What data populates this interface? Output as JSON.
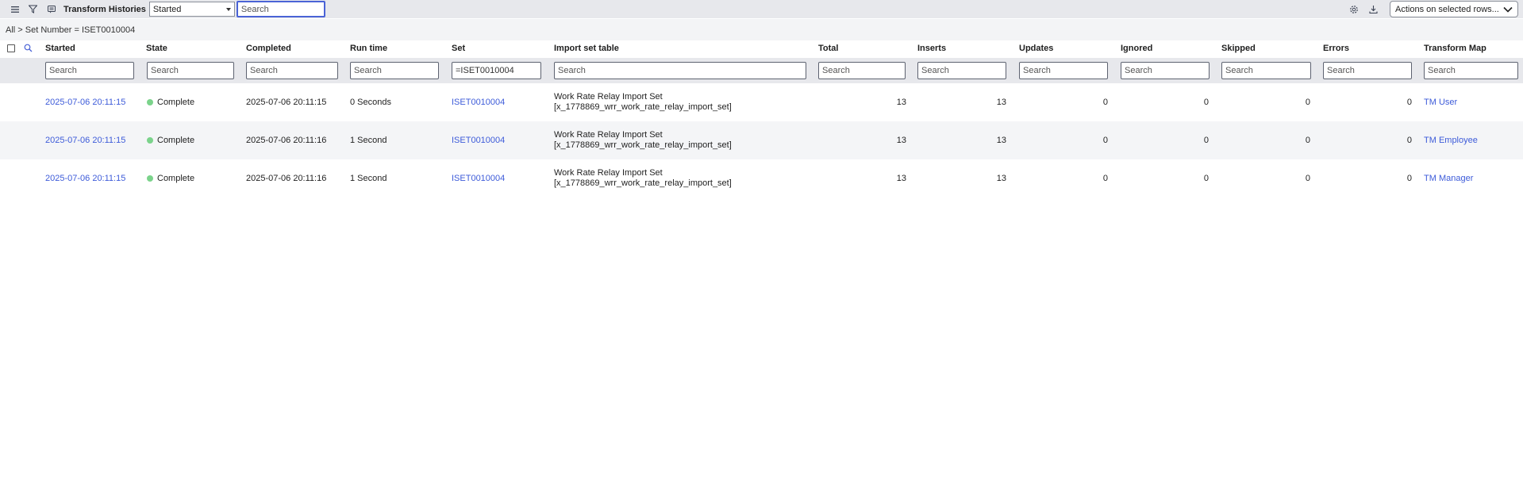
{
  "toolbar": {
    "title": "Transform Histories",
    "field_select": "Started",
    "search_placeholder": "Search",
    "actions_label": "Actions on selected rows..."
  },
  "breadcrumb": "All > Set Number = ISET0010004",
  "columns": [
    {
      "label": "Started",
      "filter_value": "",
      "filter_placeholder": "Search"
    },
    {
      "label": "State",
      "filter_value": "",
      "filter_placeholder": "Search"
    },
    {
      "label": "Completed",
      "filter_value": "",
      "filter_placeholder": "Search"
    },
    {
      "label": "Run time",
      "filter_value": "",
      "filter_placeholder": "Search"
    },
    {
      "label": "Set",
      "filter_value": "=ISET0010004",
      "filter_placeholder": "Search"
    },
    {
      "label": "Import set table",
      "filter_value": "",
      "filter_placeholder": "Search"
    },
    {
      "label": "Total",
      "filter_value": "",
      "filter_placeholder": "Search"
    },
    {
      "label": "Inserts",
      "filter_value": "",
      "filter_placeholder": "Search"
    },
    {
      "label": "Updates",
      "filter_value": "",
      "filter_placeholder": "Search"
    },
    {
      "label": "Ignored",
      "filter_value": "",
      "filter_placeholder": "Search"
    },
    {
      "label": "Skipped",
      "filter_value": "",
      "filter_placeholder": "Search"
    },
    {
      "label": "Errors",
      "filter_value": "",
      "filter_placeholder": "Search"
    },
    {
      "label": "Transform Map",
      "filter_value": "",
      "filter_placeholder": "Search"
    }
  ],
  "rows": [
    {
      "started": "2025-07-06 20:11:15",
      "state": "Complete",
      "completed": "2025-07-06 20:11:15",
      "run_time": "0 Seconds",
      "set": "ISET0010004",
      "import_set_table_line1": "Work Rate Relay Import Set",
      "import_set_table_line2": "[x_1778869_wrr_work_rate_relay_import_set]",
      "total": "13",
      "inserts": "13",
      "updates": "0",
      "ignored": "0",
      "skipped": "0",
      "errors": "0",
      "transform_map": "TM User"
    },
    {
      "started": "2025-07-06 20:11:15",
      "state": "Complete",
      "completed": "2025-07-06 20:11:16",
      "run_time": "1 Second",
      "set": "ISET0010004",
      "import_set_table_line1": "Work Rate Relay Import Set",
      "import_set_table_line2": "[x_1778869_wrr_work_rate_relay_import_set]",
      "total": "13",
      "inserts": "13",
      "updates": "0",
      "ignored": "0",
      "skipped": "0",
      "errors": "0",
      "transform_map": "TM Employee"
    },
    {
      "started": "2025-07-06 20:11:15",
      "state": "Complete",
      "completed": "2025-07-06 20:11:16",
      "run_time": "1 Second",
      "set": "ISET0010004",
      "import_set_table_line1": "Work Rate Relay Import Set",
      "import_set_table_line2": "[x_1778869_wrr_work_rate_relay_import_set]",
      "total": "13",
      "inserts": "13",
      "updates": "0",
      "ignored": "0",
      "skipped": "0",
      "errors": "0",
      "transform_map": "TM Manager"
    }
  ],
  "colors": {
    "accent": "#4a63d6",
    "link": "#3d5bd9",
    "state_complete": "#7bd38b",
    "toolbar_bg": "#e7e8ec"
  }
}
